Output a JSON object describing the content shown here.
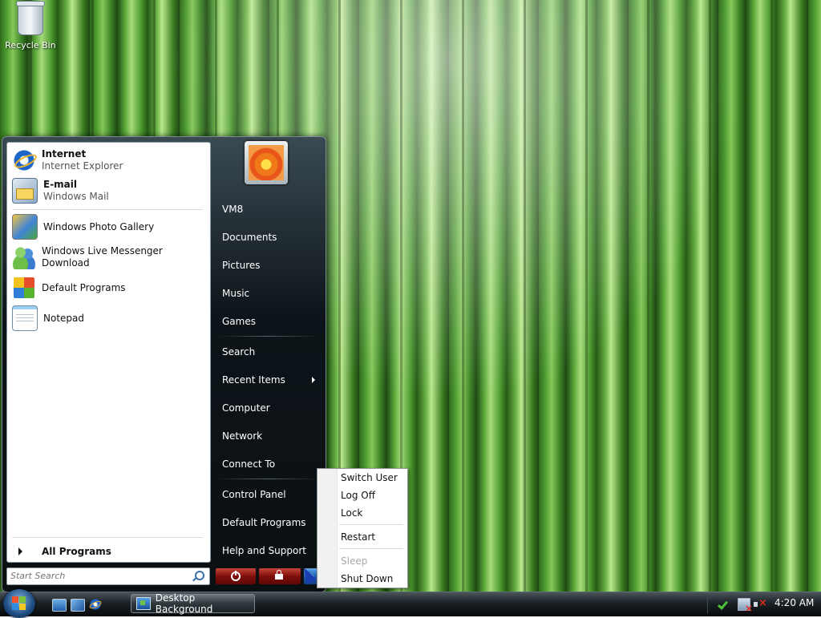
{
  "desktop": {
    "icons": [
      {
        "label": "Recycle Bin",
        "icon": "recycle-bin-icon"
      }
    ]
  },
  "start_menu": {
    "pinned": [
      {
        "title": "Internet",
        "subtitle": "Internet Explorer",
        "icon": "internet-explorer-icon"
      },
      {
        "title": "E-mail",
        "subtitle": "Windows Mail",
        "icon": "windows-mail-icon"
      }
    ],
    "recent": [
      {
        "title": "Windows Photo Gallery",
        "icon": "photo-gallery-icon"
      },
      {
        "title": "Windows Live Messenger Download",
        "icon": "messenger-icon"
      },
      {
        "title": "Default Programs",
        "icon": "default-programs-icon"
      },
      {
        "title": "Notepad",
        "icon": "notepad-icon"
      }
    ],
    "all_programs": "All Programs",
    "search_placeholder": "Start Search",
    "right_items": [
      {
        "label": "VM8"
      },
      {
        "label": "Documents"
      },
      {
        "label": "Pictures"
      },
      {
        "label": "Music"
      },
      {
        "label": "Games"
      },
      {
        "label": "Search"
      },
      {
        "label": "Recent Items",
        "has_submenu": true
      },
      {
        "label": "Computer"
      },
      {
        "label": "Network"
      },
      {
        "label": "Connect To"
      },
      {
        "label": "Control Panel"
      },
      {
        "label": "Default Programs"
      },
      {
        "label": "Help and Support"
      }
    ],
    "power_buttons": [
      "power-icon",
      "lock-icon",
      "arrow-right-icon"
    ]
  },
  "shutdown_menu": {
    "items": [
      {
        "label": "Switch User",
        "enabled": true
      },
      {
        "label": "Log Off",
        "enabled": true
      },
      {
        "label": "Lock",
        "enabled": true
      },
      {
        "label": "Restart",
        "enabled": true
      },
      {
        "label": "Sleep",
        "enabled": false
      },
      {
        "label": "Shut Down",
        "enabled": true
      }
    ]
  },
  "taskbar": {
    "quick_launch": [
      "show-desktop-icon",
      "switch-windows-icon",
      "internet-explorer-icon"
    ],
    "tasks": [
      {
        "label": "Desktop Background",
        "icon": "desktop-background-icon"
      }
    ],
    "tray_icons": [
      "windows-defender-icon",
      "network-disconnected-icon",
      "volume-muted-icon"
    ],
    "clock": "4:20 AM"
  }
}
